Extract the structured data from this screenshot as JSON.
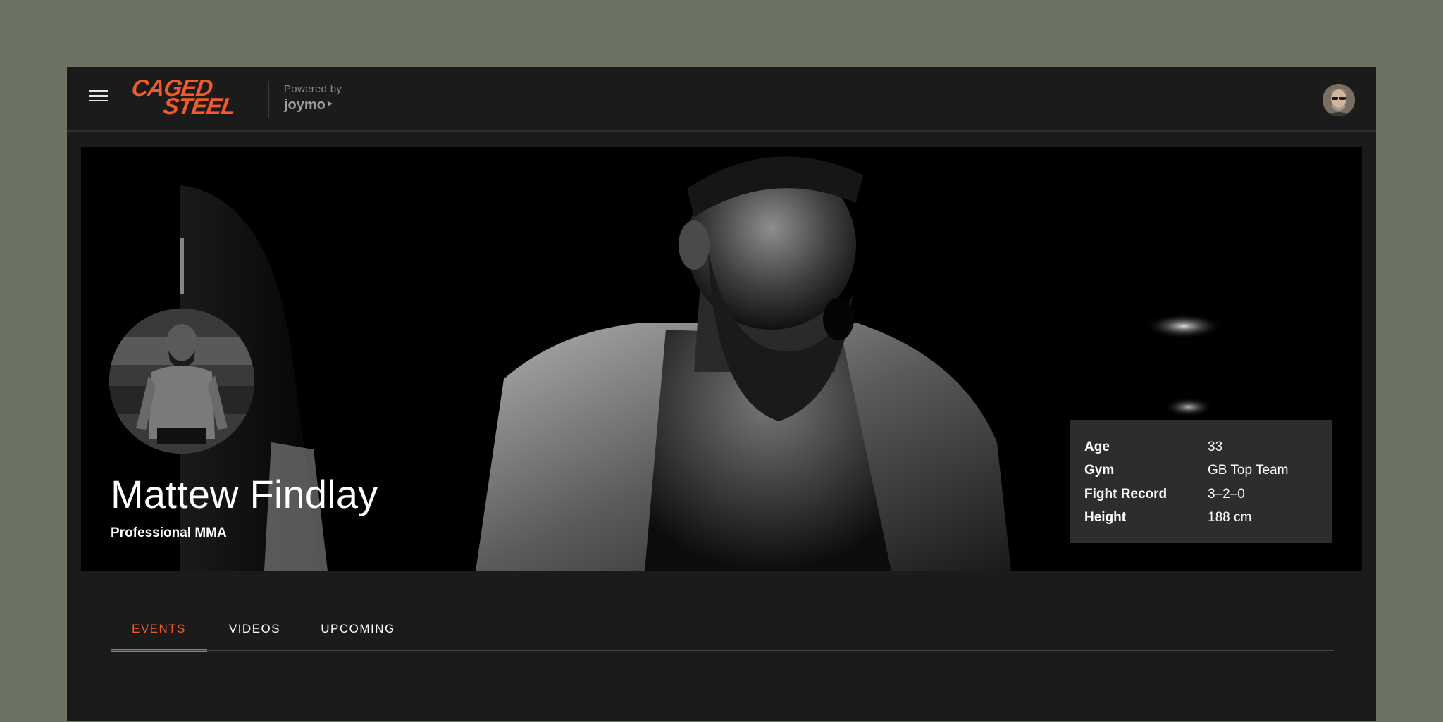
{
  "header": {
    "menu_icon": "hamburger-menu-icon",
    "logo": {
      "line1": "CAGED",
      "line2": "STEEL",
      "color": "#f15a29"
    },
    "powered_by": "Powered by",
    "powered_brand": "joymo",
    "avatar": "user-avatar"
  },
  "fighter": {
    "name": "Mattew Findlay",
    "subtitle": "Professional MMA",
    "stats": [
      {
        "label": "Age",
        "value": "33"
      },
      {
        "label": "Gym",
        "value": "GB Top Team"
      },
      {
        "label": "Fight Record",
        "value": "3–2–0"
      },
      {
        "label": "Height",
        "value": "188 cm"
      }
    ]
  },
  "tabs": [
    {
      "label": "EVENTS",
      "active": true
    },
    {
      "label": "VIDEOS",
      "active": false
    },
    {
      "label": "UPCOMING",
      "active": false
    }
  ],
  "colors": {
    "accent": "#f15a29",
    "background": "#1b1b1b",
    "page": "#6c7362",
    "stats_panel": "#2d2d2d"
  }
}
